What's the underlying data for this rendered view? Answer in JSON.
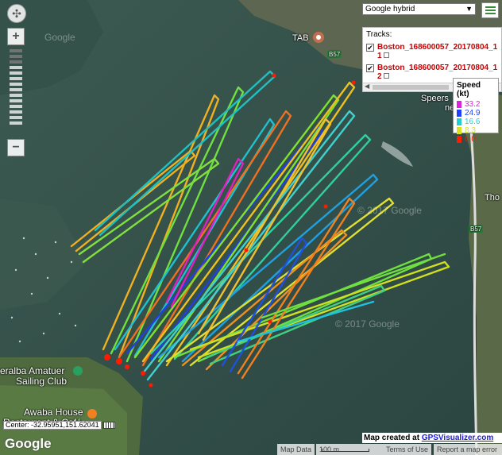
{
  "map": {
    "labels": {
      "tab": "TAB",
      "road_b57_top": "B57",
      "road_b57_right": "B57",
      "speers": "Speers",
      "road_e": "ne Esp",
      "tho": "Tho",
      "sailing_club_1": "eralba Amatuer",
      "sailing_club_2": "Sailing Club",
      "awaba_1": "Awaba House",
      "awaba_2": "Restaurant & Café",
      "copyright_1": "© 2017 Google",
      "copyright_2": "© 2017 Google",
      "faint_google": "Google"
    }
  },
  "controls": {
    "pan_icon": "compass-pan-icon",
    "zoom_in": "+",
    "zoom_out": "−",
    "map_type": "Google hybrid",
    "map_type_arrow": "▼",
    "menu_icon": "hamburger-menu-icon"
  },
  "tracks_panel": {
    "title": "Tracks:",
    "items": [
      {
        "name": "Boston_168600057_20170804_1",
        "suffix": "1",
        "checked": "✔"
      },
      {
        "name": "Boston_168600057_20170804_1",
        "suffix": "2",
        "checked": "✔"
      }
    ],
    "scroll_left": "◀"
  },
  "legend": {
    "title": "Speed (kt)",
    "entries": [
      {
        "label": "33.2",
        "color": "#e020e0"
      },
      {
        "label": "24.9",
        "color": "#2040ff"
      },
      {
        "label": "16.6",
        "color": "#20d0d0"
      },
      {
        "label": "8.3",
        "color": "#d8e020"
      },
      {
        "label": "0.0",
        "color": "#ff1a00"
      }
    ]
  },
  "footer": {
    "center": "Center: -32.95951,151.62041",
    "google_logo": "Google",
    "map_data": "Map Data",
    "scale": "100 m",
    "terms": "Terms of Use",
    "report": "Report a map error",
    "created_prefix": "Map created at ",
    "created_link": "GPSVisualizer.com"
  },
  "colors": {
    "water": "#2f4a44",
    "land": "#4a5a3a"
  }
}
